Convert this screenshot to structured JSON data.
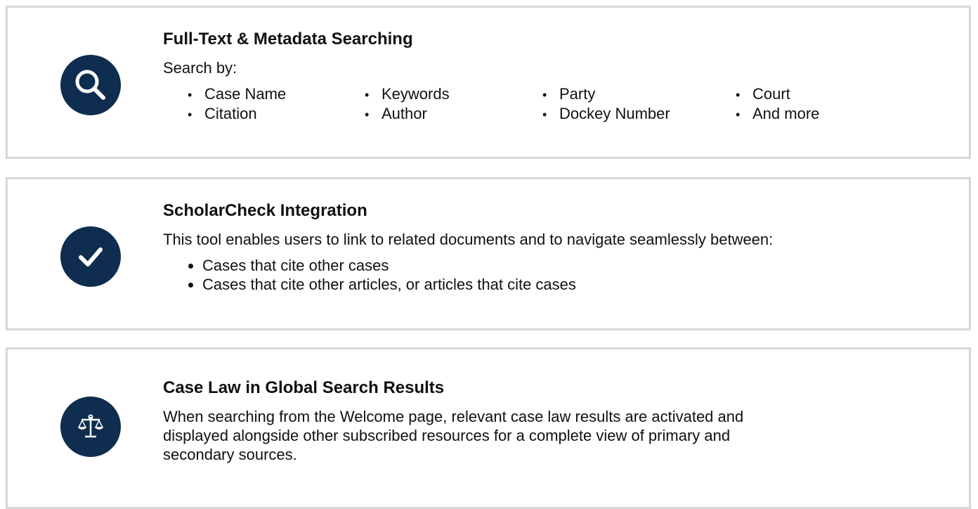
{
  "cards": [
    {
      "title": "Full-Text & Metadata Searching",
      "description": "Search by:",
      "icon": "search-icon",
      "search_fields": [
        "Case Name",
        "Citation",
        "Keywords",
        "Author",
        "Party",
        "Dockey Number",
        "Court",
        "And more"
      ]
    },
    {
      "title": "ScholarCheck Integration",
      "description": "This tool enables users to link to related documents and to navigate seamlessly between:",
      "icon": "checkmark-icon",
      "items": [
        "Cases that cite other cases",
        "Cases that cite other articles, or articles that cite cases"
      ]
    },
    {
      "title": "Case Law in Global Search Results",
      "description": "When searching from the Welcome page, relevant case law results are activated and displayed alongside other subscribed resources for a complete view of primary and secondary sources.",
      "icon": "scales-icon"
    }
  ],
  "colors": {
    "icon_background": "#0e2d4f",
    "card_border": "#d7d7d7"
  }
}
